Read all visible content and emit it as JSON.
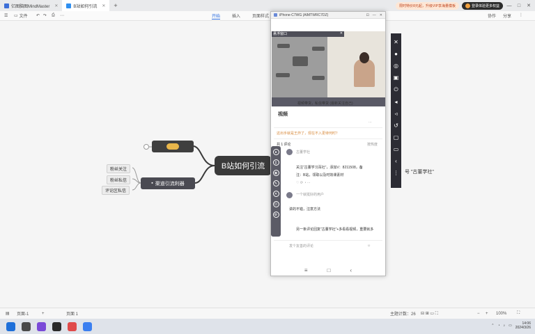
{
  "titlebar": {
    "tabs": [
      {
        "label": "亿图脑图MindMaster",
        "active": false
      },
      {
        "label": "B站如何引流",
        "active": true
      }
    ],
    "promo": "限时特价8元起，升级VIP享海量模板",
    "login": "登录体验更多权益",
    "min": "—",
    "max": "□",
    "close": "✕"
  },
  "toolbar": {
    "file": "文件",
    "menus": [
      "开始",
      "插入",
      "页面样式"
    ],
    "right": [
      "协作",
      "分享"
    ]
  },
  "mindmap": {
    "central": "B站如何引流",
    "branch": "渠道引流利器",
    "leaves": [
      "粉丝关注",
      "粉丝私信",
      "评论区私信"
    ],
    "right_text": "号 \"古董学社\""
  },
  "phone": {
    "window_title": "iPhone-C7WG (AIMTWRC7DZ)",
    "overlay_title": "悬浮窗口",
    "video_caption": "视频带货，私信带货   (最新关注自己)",
    "like_row": "这出手就是王炸了，现在不入更待何时？",
    "comment_header": "共 1 评论",
    "sort": "按热度",
    "c1_line1": "关注“古董学习百社”，添加V：8211508，备",
    "c1_line2": "注：B站，领取以及时效课素材",
    "c2_user": "一个就挺好的用户",
    "c2_text": "讲的不错，注意方法",
    "c2_reply": "另一条评论回复“古董学社”+多看看视频，重要就多",
    "input_placeholder": "发个友善的评论",
    "nav": [
      "≡",
      "□",
      "‹"
    ]
  },
  "statusbar": {
    "left": "页面-1",
    "page": "页面 1",
    "topic_count": "主题计数：26",
    "zoom": "100%"
  },
  "taskbar": {
    "time": "14:06",
    "date": "2024/3/26"
  },
  "colors": {
    "central": "#3a3a3a",
    "branch": "#4a4a52",
    "accent": "#2f6fe0"
  }
}
